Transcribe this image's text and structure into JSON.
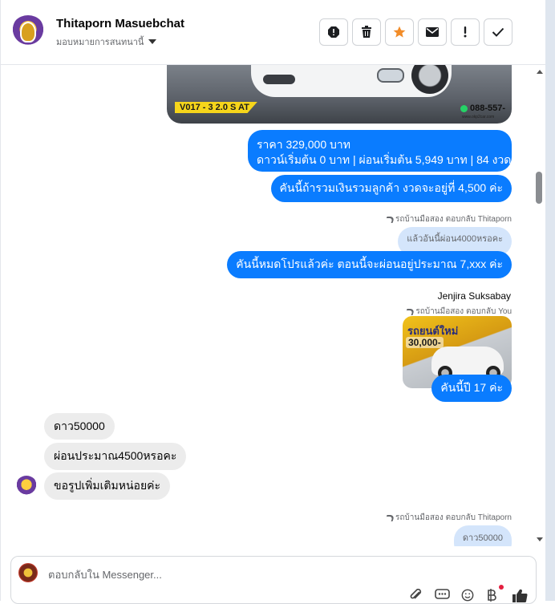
{
  "header": {
    "name": "Thitaporn Masuebchat",
    "assign_label": "มอบหมายการสนทนานี้",
    "actions": [
      "spam-icon",
      "trash-icon",
      "star-icon",
      "mail-icon",
      "exclamation-icon",
      "check-icon"
    ]
  },
  "messages": {
    "image1": {
      "plate": "V017 - 3 2.0 S AT",
      "phone": "088-557-",
      "web": "www.okp2car.com"
    },
    "price": {
      "line1": "ราคา 329,000 บาท",
      "line2": "ดาวน์เริ่มต้น 0 บาท | ผ่อนเริ่มต้น 5,949 บาท | 84 งวด"
    },
    "msg_total": "คันนี้ถ้ารวมเงินรวมลูกค้า งวดจะอยู่ที่ 4,500 ค่ะ",
    "reply1_meta": "รถบ้านมือสอง ตอบกลับ Thitaporn",
    "reply1_quote": "แล้วอันนี้ผ่อน4000หรอคะ",
    "reply1_text": "คันนี้หมดโปรแล้วค่ะ ตอนนี้จะผ่อนอยู่ประมาณ 7,xxx ค่ะ",
    "sender2": "Jenjira Suksabay",
    "reply2_meta": "รถบ้านมือสอง ตอบกลับ You",
    "image2": {
      "title": "รถยนต์ใหม่",
      "price": "30,000-"
    },
    "reply2_text": "คันนี้ปี 17 ค่ะ",
    "incoming": [
      "ดาว50000",
      "ผ่อนประมาณ4500หรอคะ",
      "ขอรูปเพิ่มเติมหน่อยค่ะ"
    ],
    "reply3_meta": "รถบ้านมือสอง ตอบกลับ Thitaporn",
    "reply3_quote": "ดาว50000"
  },
  "composer": {
    "placeholder": "ตอบกลับใน Messenger..."
  },
  "colors": {
    "outgoing": "#0a7cff",
    "incoming": "#ececec",
    "quote": "#d4e5fb",
    "star": "#f28c28"
  }
}
